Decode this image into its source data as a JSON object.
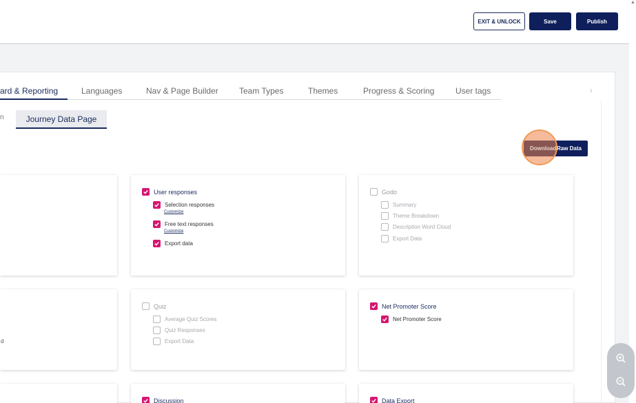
{
  "header": {
    "exit_label": "EXIT & UNLOCK",
    "save_label": "Save",
    "publish_label": "Publish"
  },
  "tabs": [
    {
      "label": "ard & Reporting",
      "active": true
    },
    {
      "label": "Languages"
    },
    {
      "label": "Nav & Page Builder"
    },
    {
      "label": "Team Types"
    },
    {
      "label": "Themes"
    },
    {
      "label": "Progress & Scoring"
    },
    {
      "label": "User tags"
    }
  ],
  "subtabs": {
    "fragment": "n",
    "active": "Journey Data Page"
  },
  "download": {
    "label": "Download Raw Data",
    "left_part": "Download",
    "right_part": "Raw Data"
  },
  "cards": {
    "user_responses": {
      "title": "User responses",
      "checked": true,
      "items": [
        {
          "label": "Selection responses",
          "checked": true,
          "customize": "Customize"
        },
        {
          "label": "Free text responses",
          "checked": true,
          "customize": "Customize"
        },
        {
          "label": "Export data",
          "checked": true
        }
      ]
    },
    "godo": {
      "title": "Godo",
      "checked": false,
      "items": [
        {
          "label": "Summary",
          "checked": false
        },
        {
          "label": "Theme Breakdown",
          "checked": false
        },
        {
          "label": "Description Word Cloud",
          "checked": false
        },
        {
          "label": "Export Data",
          "checked": false
        }
      ]
    },
    "quiz": {
      "title": "Quiz",
      "checked": false,
      "items": [
        {
          "label": "Average Quiz Scores",
          "checked": false
        },
        {
          "label": "Quiz Responses",
          "checked": false
        },
        {
          "label": "Export Data",
          "checked": false
        }
      ]
    },
    "nps": {
      "title": "Net Promoter Score",
      "checked": true,
      "items": [
        {
          "label": "Net Promoter Score",
          "checked": true
        }
      ]
    },
    "discussion": {
      "title": "Discussion",
      "checked": true
    },
    "data_export": {
      "title": "Data Export",
      "checked": true
    },
    "left_fragment_text": "d"
  },
  "colors": {
    "navy": "#0f1f5c",
    "checkbox_on": "#d6166f",
    "highlight": "#f09a55"
  }
}
